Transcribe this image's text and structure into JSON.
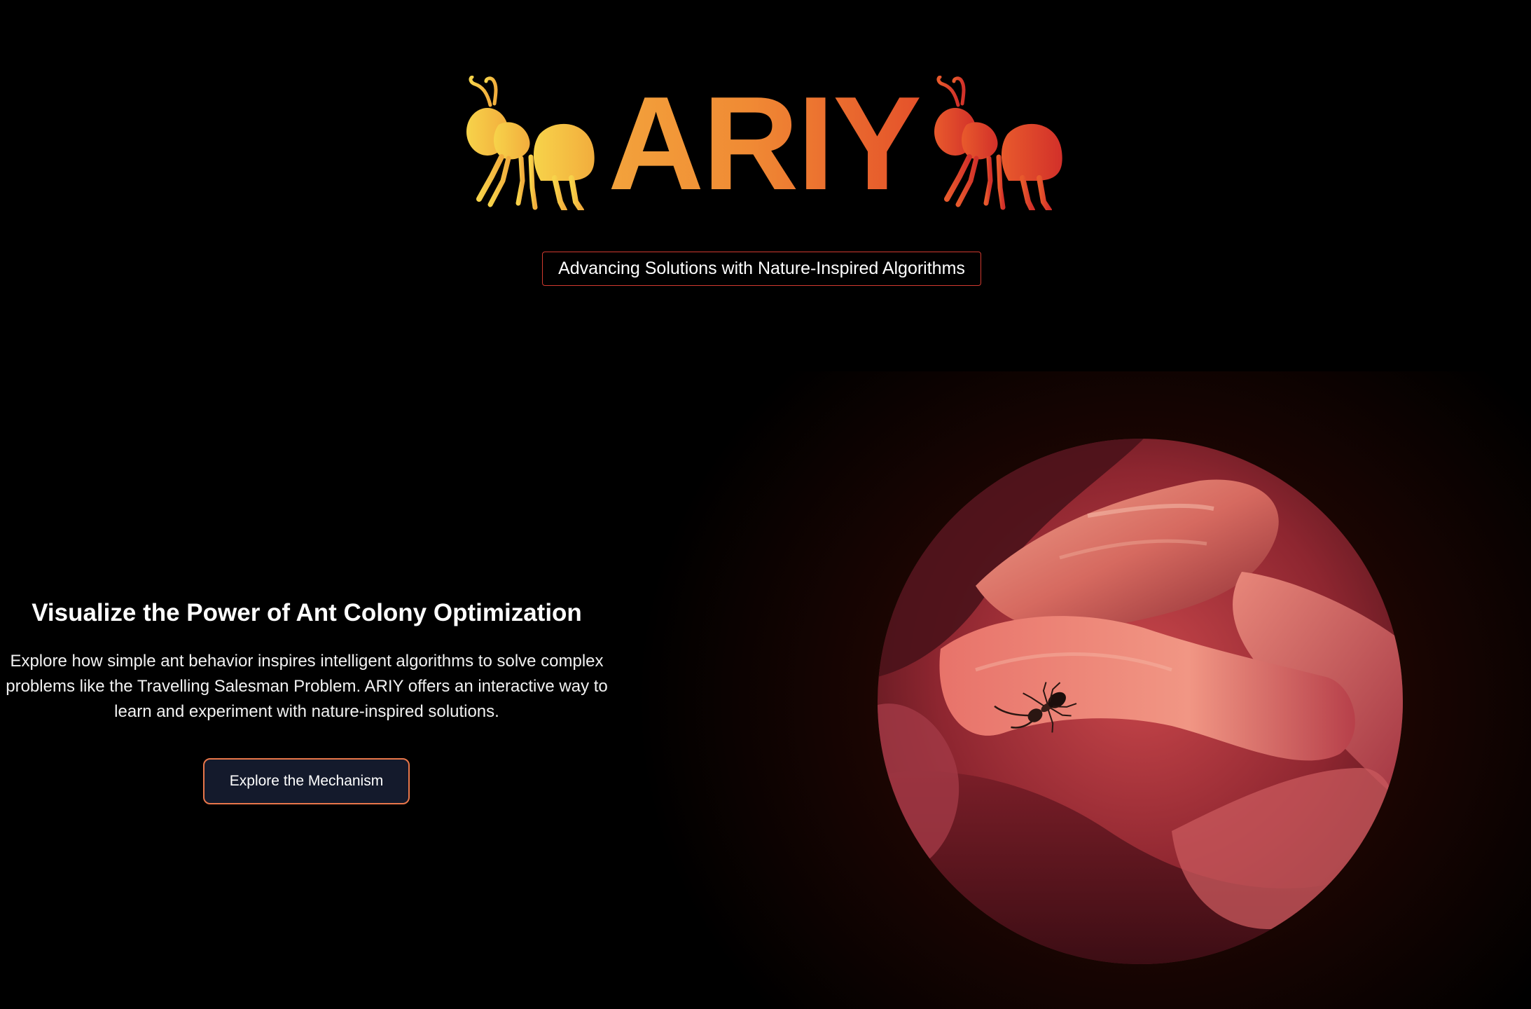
{
  "brand": {
    "name": "ARIY",
    "tagline": "Advancing Solutions with Nature-Inspired Algorithms",
    "gradient": [
      "#f7d04a",
      "#f08a34",
      "#e4402a",
      "#d2302a"
    ]
  },
  "hero": {
    "title": "Visualize the Power of Ant Colony Optimization",
    "description": "Explore how simple ant behavior inspires intelligent algorithms to solve complex problems like the Travelling Salesman Problem. ARIY offers an interactive way to learn and experiment with nature-inspired solutions.",
    "button_label": "Explore the Mechanism",
    "image_subject": "ant on red flower petals",
    "accent_color": "#e8764a",
    "button_bg": "#141a2c"
  },
  "icons": {
    "left": "ant-icon",
    "right": "ant-icon"
  }
}
